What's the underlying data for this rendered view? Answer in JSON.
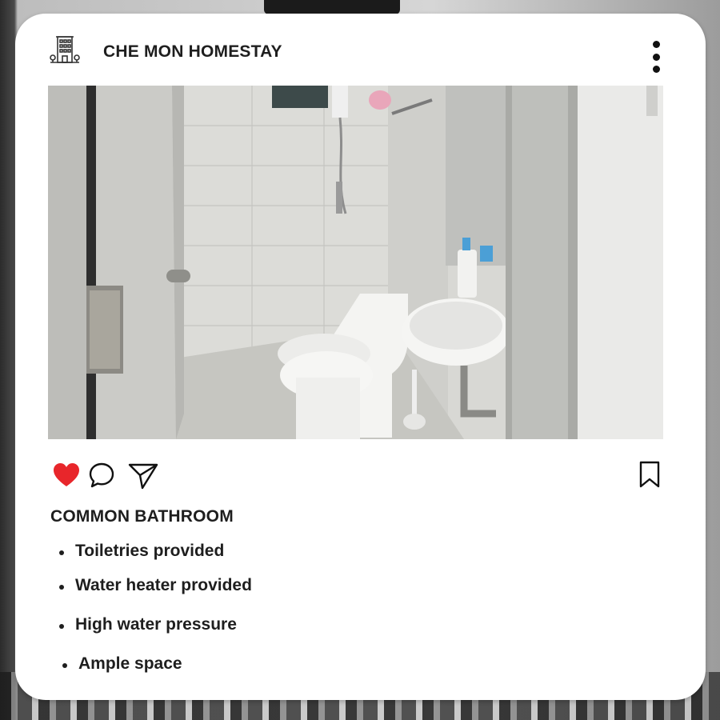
{
  "post": {
    "account_name": "CHE MON HOMESTAY",
    "logo_icon": "building-icon",
    "menu_icon": "more-vertical-icon",
    "photo_subject": "",
    "caption_title": "COMMON BATHROOM",
    "features": [
      "Toiletries provided",
      "Water heater provided",
      "High water pressure",
      "Ample space"
    ]
  },
  "actions": {
    "like_icon": "heart-icon",
    "like_active": true,
    "comment_icon": "comment-icon",
    "share_icon": "send-icon",
    "save_icon": "bookmark-icon"
  },
  "colors": {
    "like": "#e8262b",
    "text": "#1e1e1e",
    "card": "#ffffff"
  }
}
